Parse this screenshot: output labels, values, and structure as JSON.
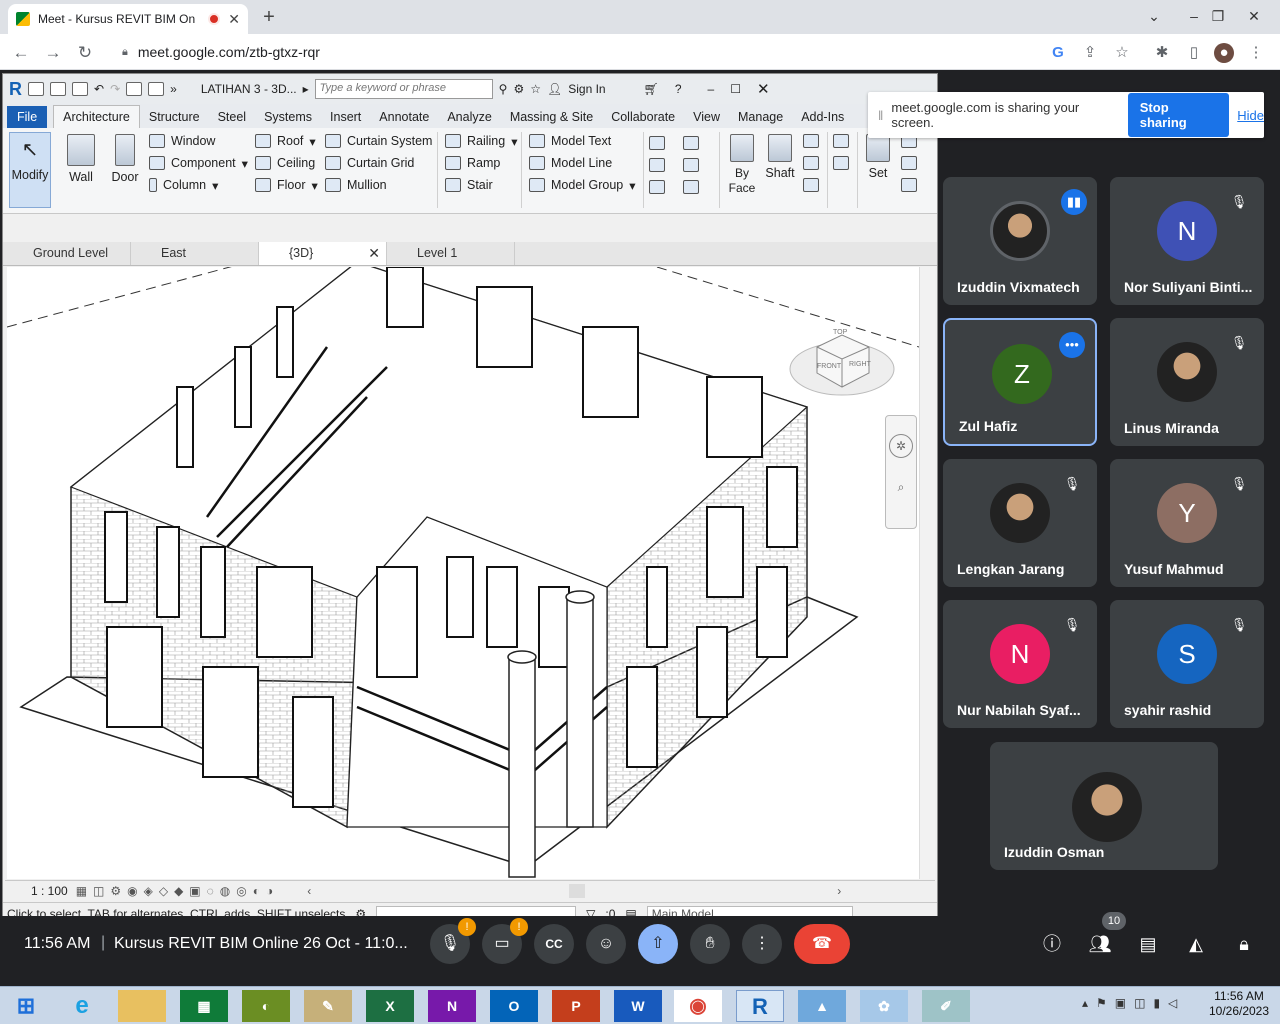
{
  "browser": {
    "tab_title": "Meet - Kursus REVIT BIM On",
    "url": "meet.google.com/ztb-gtxz-rqr"
  },
  "revit": {
    "project_title": "LATIHAN 3 - 3D...",
    "search_placeholder": "Type a keyword or phrase",
    "sign_in": "Sign In",
    "tabs": [
      "File",
      "Architecture",
      "Structure",
      "Steel",
      "Systems",
      "Insert",
      "Annotate",
      "Analyze",
      "Massing & Site",
      "Collaborate",
      "View",
      "Manage",
      "Add-Ins"
    ],
    "tools": {
      "modify": "Modify",
      "wall": "Wall",
      "door": "Door",
      "window": "Window",
      "component": "Component",
      "column": "Column",
      "roof": "Roof",
      "ceiling": "Ceiling",
      "floor": "Floor",
      "curtain_system": "Curtain System",
      "curtain_grid": "Curtain Grid",
      "mullion": "Mullion",
      "railing": "Railing",
      "ramp": "Ramp",
      "stair": "Stair",
      "model_text": "Model Text",
      "model_line": "Model Line",
      "model_group": "Model Group",
      "by_face": "By Face",
      "shaft": "Shaft",
      "set": "Set"
    },
    "views": [
      "Ground Level",
      "East",
      "{3D}",
      "Level 1"
    ],
    "scale": "1 : 100",
    "status": "Click to select, TAB for alternates, CTRL adds, SHIFT unselects",
    "select_count": ":0",
    "workset": "Main Model",
    "viewcube": {
      "top": "TOP",
      "front": "FRONT",
      "right": "RIGHT"
    }
  },
  "share_banner": {
    "text": "meet.google.com is sharing your screen.",
    "stop": "Stop sharing",
    "hide": "Hide"
  },
  "participants": [
    {
      "name": "Izuddin Vixmatech",
      "initial": "",
      "color": "#3c4043"
    },
    {
      "name": "Nor Suliyani Binti...",
      "initial": "N",
      "color": "#3f51b5"
    },
    {
      "name": "Zul Hafiz",
      "initial": "Z",
      "color": "#33691e"
    },
    {
      "name": "Linus Miranda",
      "initial": "",
      "color": "#3c4043"
    },
    {
      "name": "Lengkan Jarang",
      "initial": "",
      "color": "#3c4043"
    },
    {
      "name": "Yusuf Mahmud",
      "initial": "Y",
      "color": "#8d6e63"
    },
    {
      "name": "Nur Nabilah Syaf...",
      "initial": "N",
      "color": "#e91e63"
    },
    {
      "name": "syahir rashid",
      "initial": "S",
      "color": "#1565c0"
    },
    {
      "name": "Izuddin Osman",
      "initial": "",
      "color": "#3c4043"
    }
  ],
  "meet_bar": {
    "time": "11:56 AM",
    "meeting": "Kursus REVIT BIM Online 26 Oct - 11:0...",
    "people_count": "10"
  },
  "taskbar": {
    "time": "11:56 AM",
    "date": "10/26/2023"
  }
}
